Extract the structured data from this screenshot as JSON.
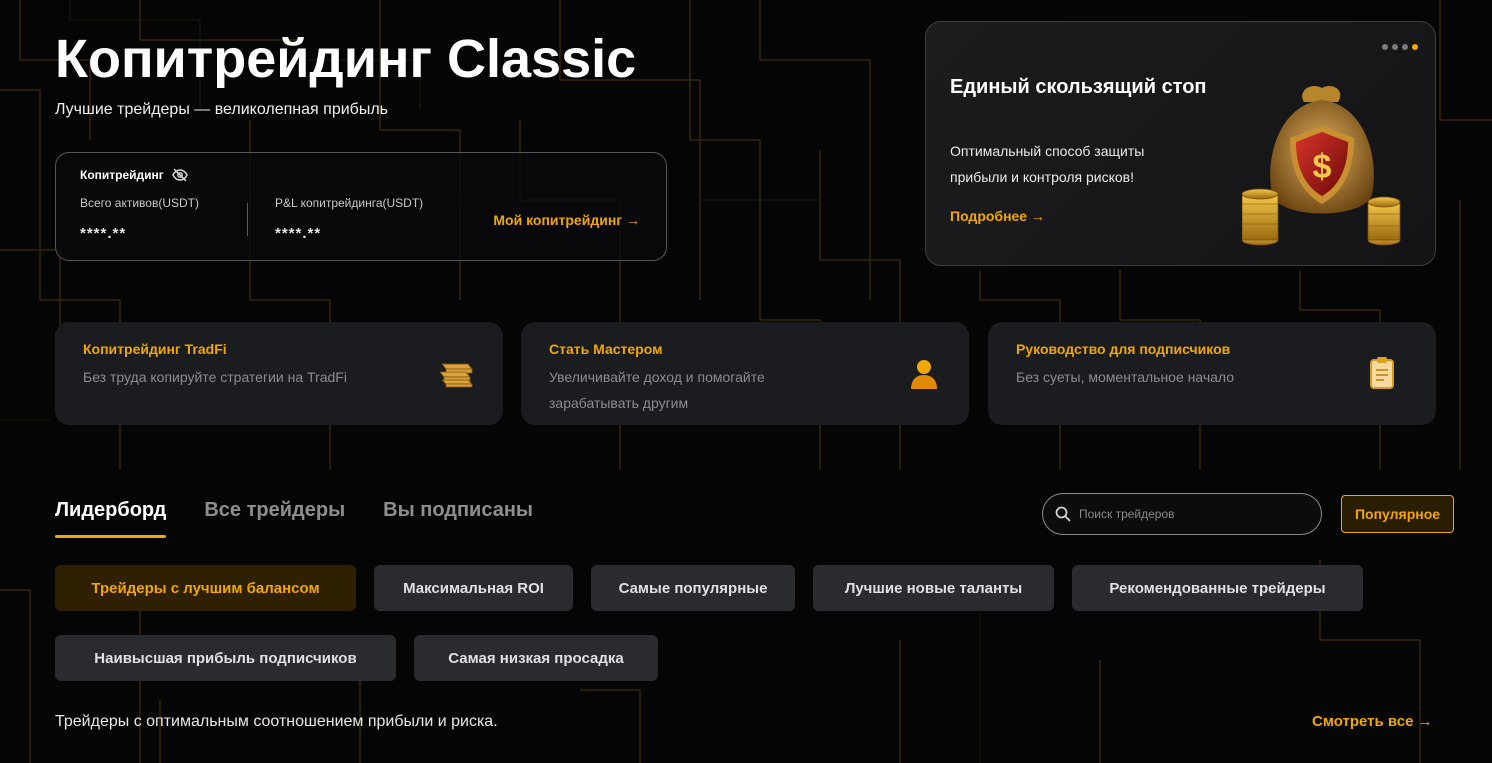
{
  "hero": {
    "title": "Копитрейдинг Classic",
    "subtitle": "Лучшие трейдеры — великолепная прибыль"
  },
  "assets": {
    "heading": "Копитрейдинг",
    "total_label": "Всего активов(USDT)",
    "total_value": "****.**",
    "pnl_label": "P&L копитрейдинга(USDT)",
    "pnl_value": "****.**",
    "link": "Мой копитрейдинг →"
  },
  "promo": {
    "title": "Единый скользящий стоп",
    "text": "Оптимальный способ защиты прибыли и контроля рисков!",
    "link": "Подробнее →",
    "slides_total": 4,
    "active_slide": 4
  },
  "features": [
    {
      "title": "Копитрейдинг TradFi",
      "desc": "Без труда копируйте стратегии на TradFi",
      "icon": "gold-bars-icon"
    },
    {
      "title": "Стать Мастером",
      "desc": "Увеличивайте доход и помогайте зарабатывать другим",
      "icon": "user-icon"
    },
    {
      "title": "Руководство для подписчиков",
      "desc": "Без суеты, моментальное начало",
      "icon": "clipboard-icon"
    }
  ],
  "tabs": [
    {
      "label": "Лидерборд",
      "active": true
    },
    {
      "label": "Все трейдеры",
      "active": false
    },
    {
      "label": "Вы подписаны",
      "active": false
    }
  ],
  "search": {
    "placeholder": "Поиск трейдеров"
  },
  "sort": {
    "label": "Популярное"
  },
  "chips": [
    {
      "label": "Трейдеры с лучшим балансом",
      "active": true
    },
    {
      "label": "Максимальная ROI",
      "active": false
    },
    {
      "label": "Самые популярные",
      "active": false
    },
    {
      "label": "Лучшие новые таланты",
      "active": false
    },
    {
      "label": "Рекомендованные трейдеры",
      "active": false
    },
    {
      "label": "Наивысшая прибыль подписчиков",
      "active": false
    },
    {
      "label": "Самая низкая просадка",
      "active": false
    }
  ],
  "footer": {
    "note": "Трейдеры с оптимальным соотношением прибыли и риска.",
    "see_all": "Смотреть все →"
  },
  "colors": {
    "accent": "#f0a800",
    "background": "#050505",
    "card": "#1b1c1f",
    "chip": "#2a2b2f"
  }
}
